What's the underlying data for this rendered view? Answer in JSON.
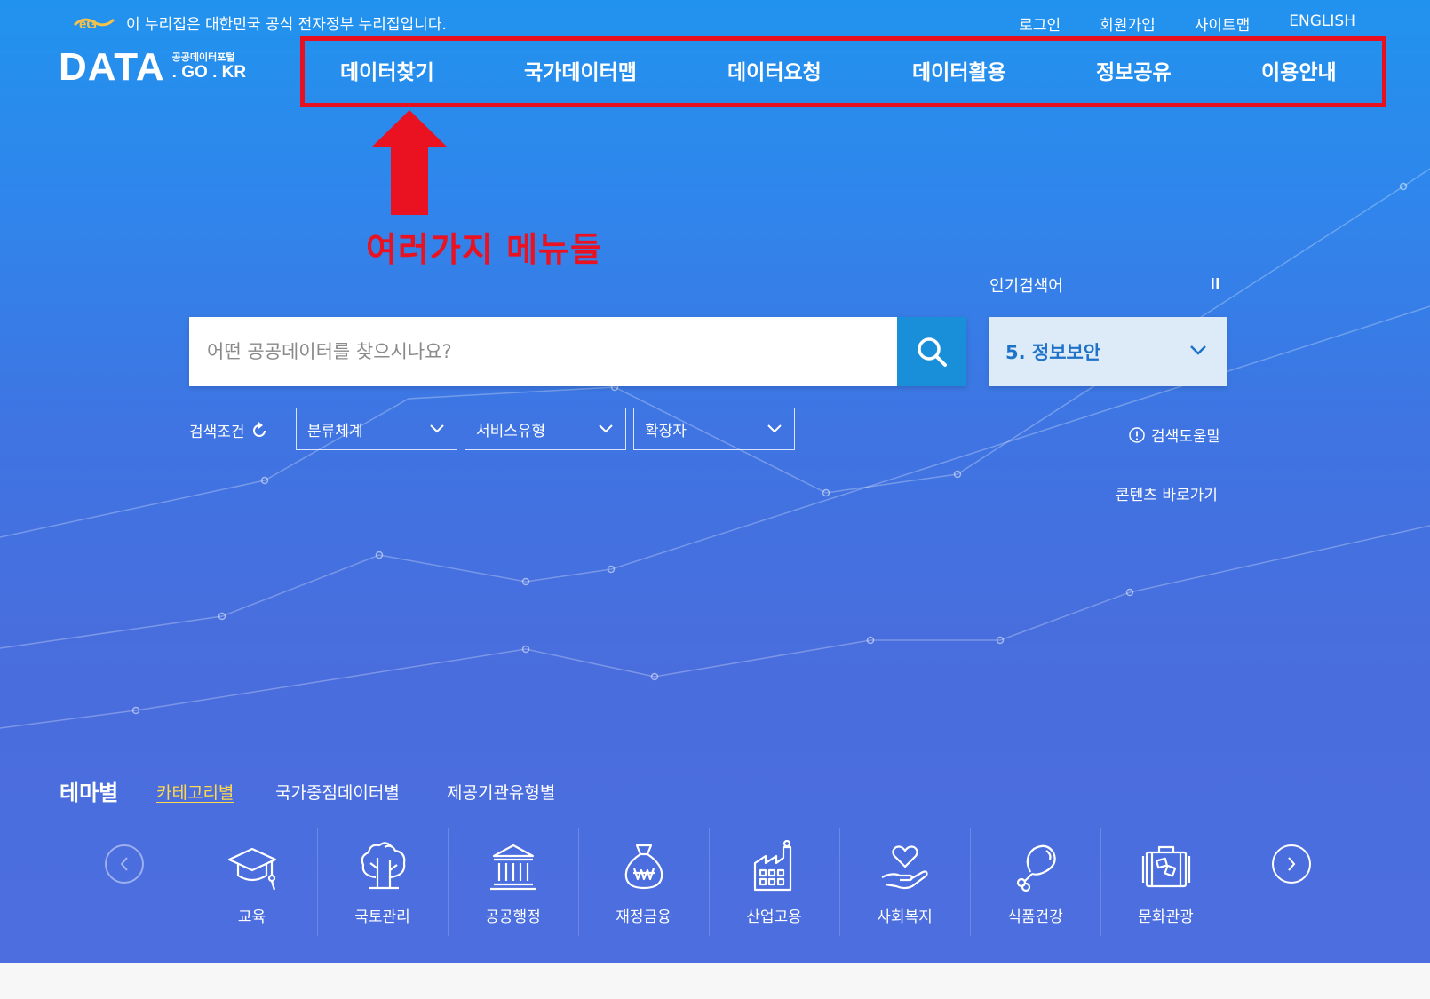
{
  "gov_banner": {
    "text": "이 누리집은 대한민국 공식 전자정부 누리집입니다.",
    "logo_icon": "egov-logo-icon"
  },
  "utility_links": [
    "로그인",
    "회원가입",
    "사이트맵",
    "ENGLISH"
  ],
  "logo": {
    "main": "DATA",
    "small": "공공데이터포털",
    "domain": ". GO . KR"
  },
  "gnb": [
    "데이터찾기",
    "국가데이터맵",
    "데이터요청",
    "데이터활용",
    "정보공유",
    "이용안내"
  ],
  "annotation": {
    "text": "여러가지 메뉴들",
    "color": "#ea1220"
  },
  "search": {
    "placeholder": "어떤 공공데이터를 찾으시나요?",
    "button_icon": "search-icon"
  },
  "popular": {
    "label": "인기검색어",
    "value": "5. 정보보안"
  },
  "conditions": {
    "label": "검색조건",
    "filters": [
      "분류체계",
      "서비스유형",
      "확장자"
    ]
  },
  "help": {
    "label": "검색도움말"
  },
  "shortcut": {
    "label": "콘텐츠 바로가기"
  },
  "theme_tabs": {
    "title": "테마별",
    "tabs": [
      "카테고리별",
      "국가중점데이터별",
      "제공기관유형별"
    ],
    "active": 0
  },
  "categories": [
    {
      "label": "교육",
      "icon": "graduation-cap-icon"
    },
    {
      "label": "국토관리",
      "icon": "tree-icon"
    },
    {
      "label": "공공행정",
      "icon": "government-building-icon"
    },
    {
      "label": "재정금융",
      "icon": "money-bag-icon"
    },
    {
      "label": "산업고용",
      "icon": "factory-icon"
    },
    {
      "label": "사회복지",
      "icon": "heart-hand-icon"
    },
    {
      "label": "식품건강",
      "icon": "drumstick-icon"
    },
    {
      "label": "문화관광",
      "icon": "suitcase-icon"
    }
  ],
  "colors": {
    "accent": "#1a8fd9",
    "active_tab": "#ffd84d",
    "highlight_box": "#e8101e"
  }
}
